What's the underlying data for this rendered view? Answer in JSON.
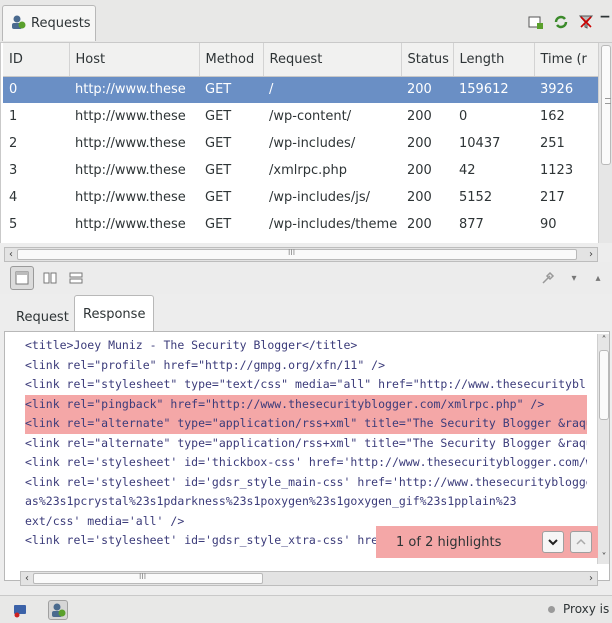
{
  "top_tabs": {
    "requests_label": "Requests"
  },
  "table": {
    "columns": [
      "ID",
      "Host",
      "Method",
      "Request",
      "Status",
      "Length",
      "Time (r"
    ],
    "rows": [
      [
        "0",
        "http://www.these",
        "GET",
        "/",
        "200",
        "159612",
        "3926"
      ],
      [
        "1",
        "http://www.these",
        "GET",
        "/wp-content/",
        "200",
        "0",
        "162"
      ],
      [
        "2",
        "http://www.these",
        "GET",
        "/wp-includes/",
        "200",
        "10437",
        "251"
      ],
      [
        "3",
        "http://www.these",
        "GET",
        "/xmlrpc.php",
        "200",
        "42",
        "1123"
      ],
      [
        "4",
        "http://www.these",
        "GET",
        "/wp-includes/js/",
        "200",
        "5152",
        "217"
      ],
      [
        "5",
        "http://www.these",
        "GET",
        "/wp-includes/theme",
        "200",
        "877",
        "90"
      ]
    ],
    "selected_row": 0,
    "hscroll_grip": "III"
  },
  "detail_tabs": {
    "request_label": "Request",
    "response_label": "Response"
  },
  "response_lines": [
    {
      "text": "<title>Joey Muniz - The Security Blogger</title>",
      "highlight": false
    },
    {
      "text": "<link rel=\"profile\" href=\"http://gmpg.org/xfn/11\" />",
      "highlight": false
    },
    {
      "text": "<link rel=\"stylesheet\" type=\"text/css\" media=\"all\" href=\"http://www.thesecuritybl",
      "highlight": false
    },
    {
      "text": "<link rel=\"pingback\" href=\"http://www.thesecurityblogger.com/xmlrpc.php\" />",
      "highlight": true
    },
    {
      "text": "<link rel=\"alternate\" type=\"application/rss+xml\" title=\"The Security Blogger &raqu",
      "highlight": true
    },
    {
      "text": "<link rel=\"alternate\" type=\"application/rss+xml\" title=\"The Security Blogger &raqu",
      "highlight": false
    },
    {
      "text": "<link rel='stylesheet' id='thickbox-css'  href='http://www.thesecurityblogger.com/w",
      "highlight": false
    },
    {
      "text": "<link rel='stylesheet' id='gdsr_style_main-css'  href='http://www.thesecurityblogge",
      "highlight": false
    },
    {
      "text": "as%23s1pcrystal%23s1pdarkness%23s1poxygen%23s1goxygen_gif%23s1pplain%23",
      "highlight": false
    },
    {
      "text": "ext/css' media='all' />",
      "highlight": false
    },
    {
      "text": "<link rel='stylesheet' id='gdsr_style_xtra-css'  href",
      "highlight": false
    }
  ],
  "highlights": {
    "label": "1 of 2 highlights"
  },
  "status": {
    "proxy_label": "Proxy is"
  },
  "colors": {
    "selection": "#6a8fc5",
    "highlight": "#f4a7a7"
  }
}
